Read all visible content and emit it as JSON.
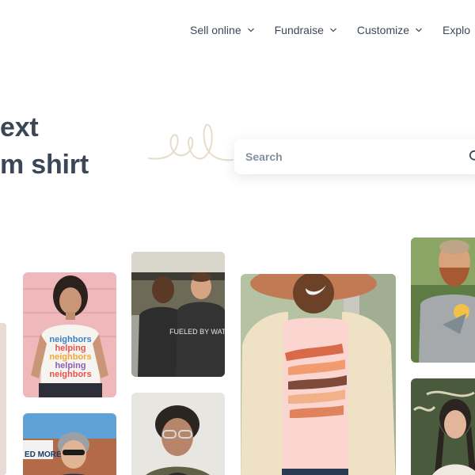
{
  "nav": {
    "items": [
      {
        "label": "Sell online"
      },
      {
        "label": "Fundraise"
      },
      {
        "label": "Customize"
      },
      {
        "label": "Explo"
      }
    ]
  },
  "hero": {
    "line1": "ext",
    "line2": "m shirt"
  },
  "search": {
    "placeholder": "Search"
  },
  "photos": {
    "neighbors_shirt": {
      "lines": [
        "neighbors",
        "helping",
        "neighbors",
        "helping",
        "neighbors"
      ]
    },
    "water_shirt": {
      "text": "FUELED BY WATER"
    },
    "banner_text": "ED MORE"
  }
}
